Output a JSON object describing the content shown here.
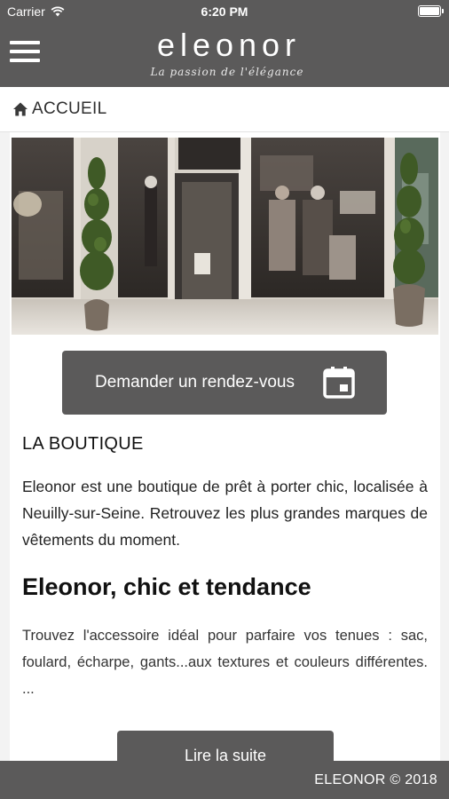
{
  "status_bar": {
    "carrier": "Carrier",
    "time": "6:20 PM",
    "battery_level": 1.0
  },
  "header": {
    "logo_name": "eleonor",
    "logo_tagline": "La passion de l'élégance",
    "menu_icon": "hamburger-menu-icon"
  },
  "breadcrumb": {
    "icon": "home-icon",
    "label": "ACCUEIL"
  },
  "hero": {
    "alt": "boutique-storefront-photo"
  },
  "appointment_button": {
    "label": "Demander un rendez-vous",
    "icon": "calendar-icon"
  },
  "boutique": {
    "title": "LA BOUTIQUE",
    "text": "Eleonor est une boutique de prêt à porter chic, localisée à Neuilly-sur-Seine. Retrouvez les plus grandes marques de vêtements du moment."
  },
  "article": {
    "heading": "Eleonor, chic et tendance",
    "text": "Trouvez l'accessoire idéal pour parfaire vos tenues : sac, foulard, écharpe, gants...aux textures et couleurs différentes. ..."
  },
  "read_more_button": {
    "label": "Lire la suite"
  },
  "footer": {
    "text": "ELEONOR © 2018"
  },
  "colors": {
    "header_bg": "#5b5a5a",
    "button_bg": "#5b5a5a",
    "page_bg": "#f3f3f3"
  }
}
